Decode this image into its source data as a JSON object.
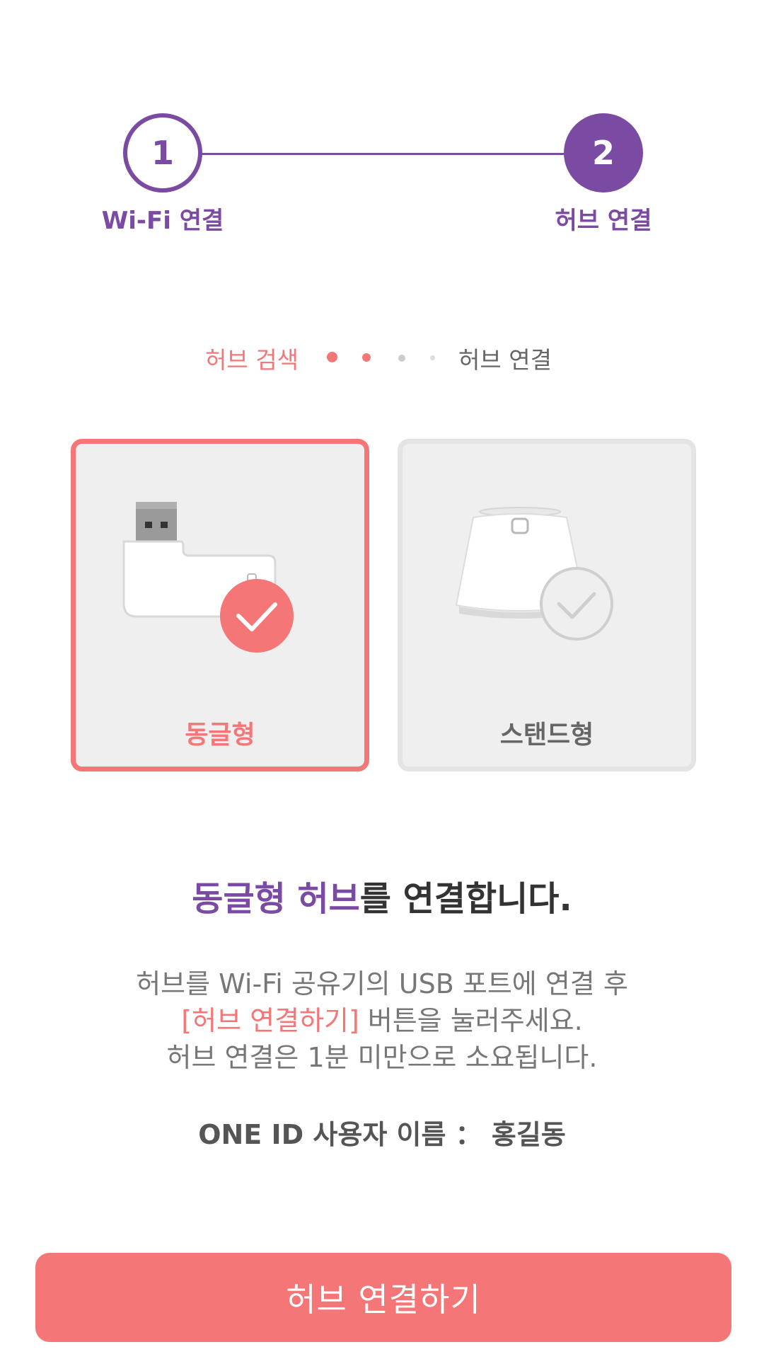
{
  "stepper": {
    "steps": [
      {
        "number": "1",
        "label": "Wi-Fi 연결",
        "state": "done"
      },
      {
        "number": "2",
        "label": "허브 연결",
        "state": "active"
      }
    ]
  },
  "progress": {
    "start_label": "허브 검색",
    "end_label": "허브 연결"
  },
  "hub_types": [
    {
      "label": "동글형",
      "selected": true,
      "icon": "usb-dongle-icon"
    },
    {
      "label": "스탠드형",
      "selected": false,
      "icon": "stand-hub-icon"
    }
  ],
  "message": {
    "headline_highlight": "동글형 허브",
    "headline_rest": "를 연결합니다.",
    "line1": "허브를 Wi-Fi 공유기의 USB 포트에 연결 후",
    "line2_accent": "[허브 연결하기]",
    "line2_rest": " 버튼을 눌러주세요.",
    "line3": "허브 연결은 1분 미만으로 소요됩니다."
  },
  "user": {
    "label": "ONE ID 사용자 이름",
    "separator": "：",
    "name": "홍길동"
  },
  "connect_button": {
    "label": "허브 연결하기"
  },
  "colors": {
    "accent": "#f47676",
    "brand_purple": "#7b4aa3",
    "card_bg": "#efefef"
  }
}
